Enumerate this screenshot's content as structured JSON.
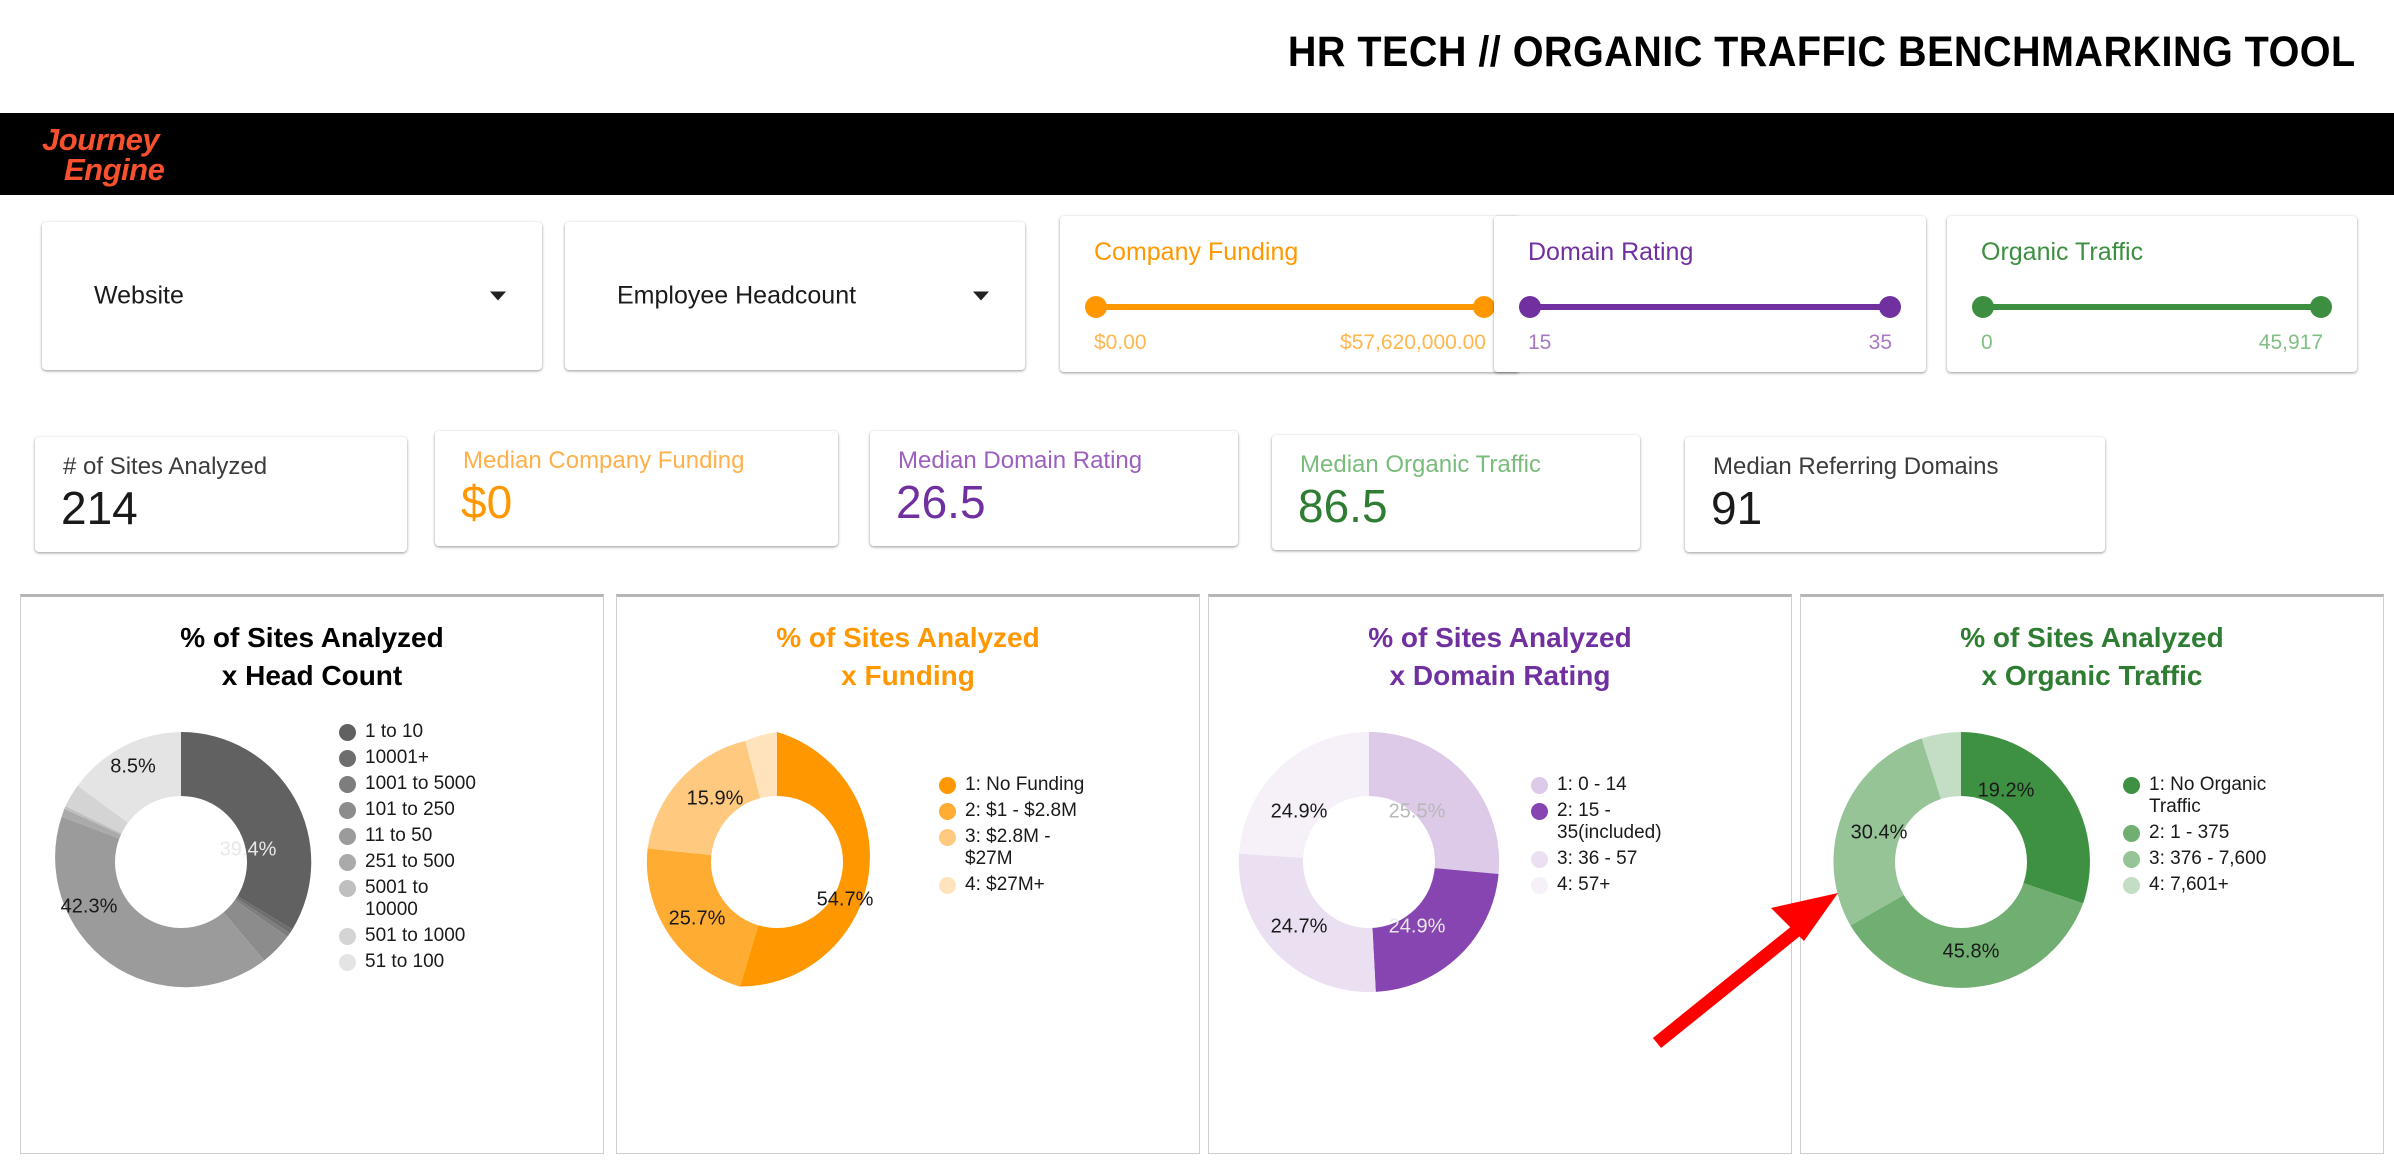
{
  "header": {
    "title": "HR TECH // ORGANIC TRAFFIC BENCHMARKING TOOL",
    "logo_line1": "Journey",
    "logo_line2": "Engine",
    "logo_color": "#F9512E"
  },
  "colors": {
    "orange": "#FF9800",
    "purple": "#7030A0",
    "green": "#3C8F40",
    "neutral": "#1a1a1a"
  },
  "filters": {
    "dropdowns": [
      {
        "name": "website",
        "label": "Website",
        "caret": "chevron-down-icon"
      },
      {
        "name": "employee-headcount",
        "label": "Employee Headcount",
        "caret": "chevron-down-icon"
      }
    ],
    "sliders": [
      {
        "name": "company-funding",
        "title": "Company Funding",
        "min": "$0.00",
        "max": "$57,620,000.00",
        "color": "#FF9800",
        "label_color": "#FFB74D"
      },
      {
        "name": "domain-rating",
        "title": "Domain Rating",
        "min": "15",
        "max": "35",
        "color": "#7030A0",
        "label_color": "#A779C4"
      },
      {
        "name": "organic-traffic",
        "title": "Organic Traffic",
        "min": "0",
        "max": "45,917",
        "color": "#3C8F40",
        "label_color": "#82BE84"
      }
    ]
  },
  "kpis": [
    {
      "name": "sites-analyzed",
      "label": "# of Sites Analyzed",
      "value": "214",
      "color": "#1a1a1a",
      "label_color": "#3c3c3c"
    },
    {
      "name": "median-company-funding",
      "label": "Median Company Funding",
      "value": "$0",
      "color": "#FF9800",
      "label_color": "#FFB04A"
    },
    {
      "name": "median-domain-rating",
      "label": "Median Domain Rating",
      "value": "26.5",
      "color": "#7030A0",
      "label_color": "#9B5FBF"
    },
    {
      "name": "median-organic-traffic",
      "label": "Median Organic Traffic",
      "value": "86.5",
      "color": "#2E7D32",
      "label_color": "#79BC7C"
    },
    {
      "name": "median-referring-domains",
      "label": "Median Referring Domains",
      "value": "91",
      "color": "#1a1a1a",
      "label_color": "#3c3c3c"
    }
  ],
  "chart_data": [
    {
      "type": "pie",
      "name": "head-count",
      "title": "% of Sites Analyzed\nx Head Count",
      "title_line1": "% of Sites Analyzed",
      "title_line2": "x Head Count",
      "title_color": "#000000",
      "legend_position": "right",
      "categories": [
        "1 to 10",
        "10001+",
        "1001 to 5000",
        "101 to 250",
        "11 to 50",
        "251 to 500",
        "5001 to 10000",
        "501 to 1000",
        "51 to 100"
      ],
      "values": [
        39.4,
        0.5,
        0.5,
        3.8,
        42.3,
        1.4,
        0.5,
        3.1,
        8.5
      ],
      "colors": [
        "#616161",
        "#6E6E6E",
        "#7D7D7D",
        "#8C8C8C",
        "#9B9B9B",
        "#AAAAAA",
        "#BFBFBF",
        "#D4D4D4",
        "#E4E4E4"
      ],
      "visible_labels": [
        {
          "text": "39.4%",
          "color": "#e8e8e8"
        },
        {
          "text": "42.3%",
          "color": "#1a1a1a"
        },
        {
          "text": "8.5%",
          "color": "#1a1a1a"
        }
      ]
    },
    {
      "type": "pie",
      "name": "funding",
      "title": "% of Sites Analyzed\nx Funding",
      "title_line1": "% of Sites Analyzed",
      "title_line2": "x Funding",
      "title_color": "#FF9800",
      "legend_position": "right",
      "categories": [
        "1: No Funding",
        "2: $1 - $2.8M",
        "3: $2.8M - $27M",
        "4: $27M+"
      ],
      "values": [
        54.7,
        25.7,
        15.9,
        3.7
      ],
      "colors": [
        "#FF9800",
        "#FFAC33",
        "#FFC97F",
        "#FFE3BD"
      ],
      "visible_labels": [
        {
          "text": "54.7%",
          "color": "#1a1a1a"
        },
        {
          "text": "25.7%",
          "color": "#1a1a1a"
        },
        {
          "text": "15.9%",
          "color": "#1a1a1a"
        }
      ]
    },
    {
      "type": "pie",
      "name": "domain-rating",
      "title": "% of Sites Analyzed\nx Domain Rating",
      "title_line1": "% of Sites Analyzed",
      "title_line2": "x Domain Rating",
      "title_color": "#7030A0",
      "legend_position": "right",
      "categories": [
        "1: 0 - 14",
        "2: 15 - 35(included)",
        "3: 36 - 57",
        "4: 57+"
      ],
      "values": [
        25.5,
        24.9,
        24.7,
        24.9
      ],
      "colors": [
        "#DCCAE8",
        "#8645B0",
        "#EBE0F2",
        "#F6F1F9"
      ],
      "visible_labels": [
        {
          "text": "25.5%",
          "color": "#b8b8b8"
        },
        {
          "text": "24.9%",
          "color": "#e8e8e8"
        },
        {
          "text": "24.7%",
          "color": "#1a1a1a"
        },
        {
          "text": "24.9%",
          "color": "#1a1a1a"
        }
      ]
    },
    {
      "type": "pie",
      "name": "organic-traffic",
      "title": "% of Sites Analyzed\nx Organic Traffic",
      "title_line1": "% of Sites Analyzed",
      "title_line2": "x Organic Traffic",
      "title_color": "#2E7D32",
      "legend_position": "right",
      "categories": [
        "1: No Organic Traffic",
        "2: 1 - 375",
        "3: 376 - 7,600",
        "4: 7,601+"
      ],
      "values": [
        19.2,
        45.8,
        30.4,
        4.6
      ],
      "colors": [
        "#3E9142",
        "#70AE72",
        "#96C497",
        "#C3DEC4"
      ],
      "visible_labels": [
        {
          "text": "19.2%",
          "color": "#1a1a1a"
        },
        {
          "text": "45.8%",
          "color": "#1a1a1a"
        },
        {
          "text": "30.4%",
          "color": "#1a1a1a"
        }
      ]
    }
  ],
  "annotation": {
    "name": "red-arrow",
    "color": "#FF0000",
    "points_at": "organic-traffic-donut"
  }
}
